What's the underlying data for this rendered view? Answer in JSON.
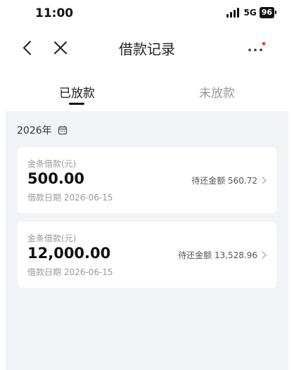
{
  "status": {
    "time": "11:00",
    "network": "5G",
    "battery": "96"
  },
  "nav": {
    "title": "借款记录"
  },
  "tabs": [
    {
      "label": "已放款",
      "active": true
    },
    {
      "label": "未放款",
      "active": false
    }
  ],
  "year": "2026年",
  "loans": [
    {
      "type": "金条借款(元)",
      "amount": "500.00",
      "date": "借款日期 2026-06-15",
      "repay": "待还金额 560.72"
    },
    {
      "type": "金条借款(元)",
      "amount": "12,000.00",
      "date": "借款日期 2026-06-15",
      "repay": "待还金额 13,528.96"
    }
  ],
  "colors": {
    "accent": "#e33b3b",
    "background": "#f2f3f6"
  }
}
